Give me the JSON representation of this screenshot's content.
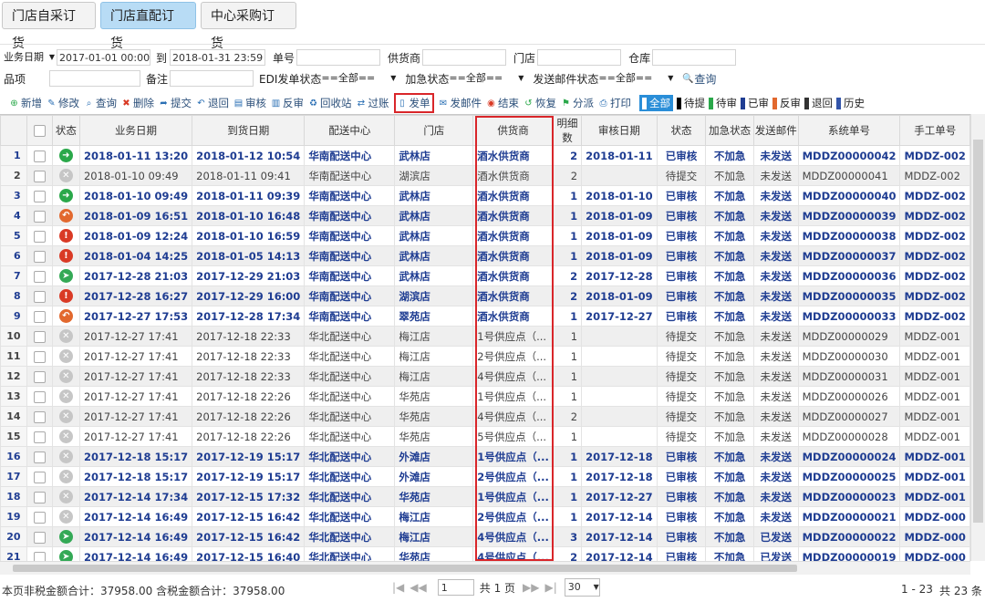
{
  "tabs": [
    "门店自采订货",
    "门店直配订货",
    "中心采购订货"
  ],
  "filters": {
    "date_label": "业务日期",
    "date_from": "2017-01-01 00:00",
    "to_label": "到",
    "date_to": "2018-01-31 23:59",
    "order_no_label": "单号",
    "supplier_label": "供货商",
    "store_label": "门店",
    "warehouse_label": "仓库",
    "item_label": "品项",
    "remark_label": "备注",
    "edi_label": "EDI发单状态",
    "edi_value": "==全部==",
    "urgent_label": "加急状态",
    "urgent_value": "==全部==",
    "mail_label": "发送邮件状态",
    "mail_value": "==全部==",
    "query_button": "查询"
  },
  "toolbar": {
    "buttons": [
      "新增",
      "修改",
      "查询",
      "删除",
      "提交",
      "退回",
      "审核",
      "反审",
      "回收站",
      "过账",
      "发单",
      "发邮件",
      "结束",
      "恢复",
      "分派",
      "打印"
    ],
    "icons": [
      "plus-icon",
      "edit-icon",
      "search-icon",
      "delete-icon",
      "submit-icon",
      "return-icon",
      "audit-icon",
      "unaudit-icon",
      "recycle-icon",
      "post-icon",
      "send-order-icon",
      "mail-icon",
      "end-icon",
      "restore-icon",
      "assign-icon",
      "print-icon"
    ],
    "status_filters": [
      {
        "label": "全部",
        "color": "#ffffff"
      },
      {
        "label": "待提",
        "color": "#000000"
      },
      {
        "label": "待审",
        "color": "#2aa84a"
      },
      {
        "label": "已审",
        "color": "#1f3d92"
      },
      {
        "label": "反审",
        "color": "#e2682e"
      },
      {
        "label": "退回",
        "color": "#333333"
      },
      {
        "label": "历史",
        "color": "#3355aa"
      }
    ]
  },
  "grid": {
    "headers": [
      "状态",
      "业务日期",
      "到货日期",
      "配送中心",
      "门店",
      "供货商",
      "明细数",
      "审核日期",
      "状态",
      "加急状态",
      "发送邮件",
      "系统单号",
      "手工单号"
    ],
    "rows": [
      {
        "n": "1",
        "icon": "green",
        "biz": "2018-01-11 13:20",
        "arr": "2018-01-12 10:54",
        "dc": "华南配送中心",
        "store": "武林店",
        "sup": "酒水供货商",
        "cnt": "2",
        "audit": "2018-01-11",
        "status": "已审核",
        "urgent": "不加急",
        "mail": "未发送",
        "sys": "MDDZ00000042",
        "manual": "MDDZ-002",
        "bold": true
      },
      {
        "n": "2",
        "icon": "grey",
        "biz": "2018-01-10 09:49",
        "arr": "2018-01-11 09:41",
        "dc": "华南配送中心",
        "store": "湖滨店",
        "sup": "酒水供货商",
        "cnt": "2",
        "audit": "",
        "status": "待提交",
        "urgent": "不加急",
        "mail": "未发送",
        "sys": "MDDZ00000041",
        "manual": "MDDZ-002",
        "bold": false
      },
      {
        "n": "3",
        "icon": "green",
        "biz": "2018-01-10 09:49",
        "arr": "2018-01-11 09:39",
        "dc": "华南配送中心",
        "store": "武林店",
        "sup": "酒水供货商",
        "cnt": "1",
        "audit": "2018-01-10",
        "status": "已审核",
        "urgent": "不加急",
        "mail": "未发送",
        "sys": "MDDZ00000040",
        "manual": "MDDZ-002",
        "bold": true
      },
      {
        "n": "4",
        "icon": "orange",
        "biz": "2018-01-09 16:51",
        "arr": "2018-01-10 16:48",
        "dc": "华南配送中心",
        "store": "武林店",
        "sup": "酒水供货商",
        "cnt": "1",
        "audit": "2018-01-09",
        "status": "已审核",
        "urgent": "不加急",
        "mail": "未发送",
        "sys": "MDDZ00000039",
        "manual": "MDDZ-002",
        "bold": true
      },
      {
        "n": "5",
        "icon": "red",
        "biz": "2018-01-09 12:24",
        "arr": "2018-01-10 16:59",
        "dc": "华南配送中心",
        "store": "武林店",
        "sup": "酒水供货商",
        "cnt": "1",
        "audit": "2018-01-09",
        "status": "已审核",
        "urgent": "不加急",
        "mail": "未发送",
        "sys": "MDDZ00000038",
        "manual": "MDDZ-002",
        "bold": true
      },
      {
        "n": "6",
        "icon": "red",
        "biz": "2018-01-04 14:25",
        "arr": "2018-01-05 14:13",
        "dc": "华南配送中心",
        "store": "武林店",
        "sup": "酒水供货商",
        "cnt": "1",
        "audit": "2018-01-09",
        "status": "已审核",
        "urgent": "不加急",
        "mail": "未发送",
        "sys": "MDDZ00000037",
        "manual": "MDDZ-002",
        "bold": true
      },
      {
        "n": "7",
        "icon": "send",
        "biz": "2017-12-28 21:03",
        "arr": "2017-12-29 21:03",
        "dc": "华南配送中心",
        "store": "武林店",
        "sup": "酒水供货商",
        "cnt": "2",
        "audit": "2017-12-28",
        "status": "已审核",
        "urgent": "不加急",
        "mail": "未发送",
        "sys": "MDDZ00000036",
        "manual": "MDDZ-002",
        "bold": true
      },
      {
        "n": "8",
        "icon": "red",
        "biz": "2017-12-28 16:27",
        "arr": "2017-12-29 16:00",
        "dc": "华南配送中心",
        "store": "湖滨店",
        "sup": "酒水供货商",
        "cnt": "2",
        "audit": "2018-01-09",
        "status": "已审核",
        "urgent": "不加急",
        "mail": "未发送",
        "sys": "MDDZ00000035",
        "manual": "MDDZ-002",
        "bold": true
      },
      {
        "n": "9",
        "icon": "orange",
        "biz": "2017-12-27 17:53",
        "arr": "2017-12-28 17:34",
        "dc": "华南配送中心",
        "store": "翠苑店",
        "sup": "酒水供货商",
        "cnt": "1",
        "audit": "2017-12-27",
        "status": "已审核",
        "urgent": "不加急",
        "mail": "未发送",
        "sys": "MDDZ00000033",
        "manual": "MDDZ-002",
        "bold": true
      },
      {
        "n": "10",
        "icon": "grey",
        "biz": "2017-12-27 17:41",
        "arr": "2017-12-18 22:33",
        "dc": "华北配送中心",
        "store": "梅江店",
        "sup": "1号供应点（...",
        "cnt": "1",
        "audit": "",
        "status": "待提交",
        "urgent": "不加急",
        "mail": "未发送",
        "sys": "MDDZ00000029",
        "manual": "MDDZ-001",
        "bold": false
      },
      {
        "n": "11",
        "icon": "grey",
        "biz": "2017-12-27 17:41",
        "arr": "2017-12-18 22:33",
        "dc": "华北配送中心",
        "store": "梅江店",
        "sup": "2号供应点（...",
        "cnt": "1",
        "audit": "",
        "status": "待提交",
        "urgent": "不加急",
        "mail": "未发送",
        "sys": "MDDZ00000030",
        "manual": "MDDZ-001",
        "bold": false
      },
      {
        "n": "12",
        "icon": "grey",
        "biz": "2017-12-27 17:41",
        "arr": "2017-12-18 22:33",
        "dc": "华北配送中心",
        "store": "梅江店",
        "sup": "4号供应点（...",
        "cnt": "1",
        "audit": "",
        "status": "待提交",
        "urgent": "不加急",
        "mail": "未发送",
        "sys": "MDDZ00000031",
        "manual": "MDDZ-001",
        "bold": false
      },
      {
        "n": "13",
        "icon": "grey",
        "biz": "2017-12-27 17:41",
        "arr": "2017-12-18 22:26",
        "dc": "华北配送中心",
        "store": "华苑店",
        "sup": "1号供应点（...",
        "cnt": "1",
        "audit": "",
        "status": "待提交",
        "urgent": "不加急",
        "mail": "未发送",
        "sys": "MDDZ00000026",
        "manual": "MDDZ-001",
        "bold": false
      },
      {
        "n": "14",
        "icon": "grey",
        "biz": "2017-12-27 17:41",
        "arr": "2017-12-18 22:26",
        "dc": "华北配送中心",
        "store": "华苑店",
        "sup": "4号供应点（...",
        "cnt": "2",
        "audit": "",
        "status": "待提交",
        "urgent": "不加急",
        "mail": "未发送",
        "sys": "MDDZ00000027",
        "manual": "MDDZ-001",
        "bold": false
      },
      {
        "n": "15",
        "icon": "grey",
        "biz": "2017-12-27 17:41",
        "arr": "2017-12-18 22:26",
        "dc": "华北配送中心",
        "store": "华苑店",
        "sup": "5号供应点（...",
        "cnt": "1",
        "audit": "",
        "status": "待提交",
        "urgent": "不加急",
        "mail": "未发送",
        "sys": "MDDZ00000028",
        "manual": "MDDZ-001",
        "bold": false
      },
      {
        "n": "16",
        "icon": "grey",
        "biz": "2017-12-18 15:17",
        "arr": "2017-12-19 15:17",
        "dc": "华北配送中心",
        "store": "外滩店",
        "sup": "1号供应点（...",
        "cnt": "1",
        "audit": "2017-12-18",
        "status": "已审核",
        "urgent": "不加急",
        "mail": "未发送",
        "sys": "MDDZ00000024",
        "manual": "MDDZ-001",
        "bold": true
      },
      {
        "n": "17",
        "icon": "grey",
        "biz": "2017-12-18 15:17",
        "arr": "2017-12-19 15:17",
        "dc": "华北配送中心",
        "store": "外滩店",
        "sup": "2号供应点（...",
        "cnt": "1",
        "audit": "2017-12-18",
        "status": "已审核",
        "urgent": "不加急",
        "mail": "未发送",
        "sys": "MDDZ00000025",
        "manual": "MDDZ-001",
        "bold": true
      },
      {
        "n": "18",
        "icon": "grey",
        "biz": "2017-12-14 17:34",
        "arr": "2017-12-15 17:32",
        "dc": "华北配送中心",
        "store": "华苑店",
        "sup": "1号供应点（...",
        "cnt": "1",
        "audit": "2017-12-27",
        "status": "已审核",
        "urgent": "不加急",
        "mail": "未发送",
        "sys": "MDDZ00000023",
        "manual": "MDDZ-001",
        "bold": true
      },
      {
        "n": "19",
        "icon": "grey",
        "biz": "2017-12-14 16:49",
        "arr": "2017-12-15 16:42",
        "dc": "华北配送中心",
        "store": "梅江店",
        "sup": "2号供应点（...",
        "cnt": "1",
        "audit": "2017-12-14",
        "status": "已审核",
        "urgent": "不加急",
        "mail": "未发送",
        "sys": "MDDZ00000021",
        "manual": "MDDZ-000",
        "bold": true
      },
      {
        "n": "20",
        "icon": "send",
        "biz": "2017-12-14 16:49",
        "arr": "2017-12-15 16:42",
        "dc": "华北配送中心",
        "store": "梅江店",
        "sup": "4号供应点（...",
        "cnt": "3",
        "audit": "2017-12-14",
        "status": "已审核",
        "urgent": "不加急",
        "mail": "已发送",
        "sys": "MDDZ00000022",
        "manual": "MDDZ-000",
        "bold": true
      },
      {
        "n": "21",
        "icon": "send",
        "biz": "2017-12-14 16:49",
        "arr": "2017-12-15 16:40",
        "dc": "华北配送中心",
        "store": "华苑店",
        "sup": "4号供应点（...",
        "cnt": "2",
        "audit": "2017-12-14",
        "status": "已审核",
        "urgent": "不加急",
        "mail": "已发送",
        "sys": "MDDZ00000019",
        "manual": "MDDZ-000",
        "bold": true
      }
    ]
  },
  "footer": {
    "summary": "本页非税金额合计：37958.00 含税金额合计：37958.00",
    "page_input": "1",
    "total_pages": "共 1 页",
    "page_size": "30",
    "range": "1 - 23",
    "total": "共 23 条"
  }
}
